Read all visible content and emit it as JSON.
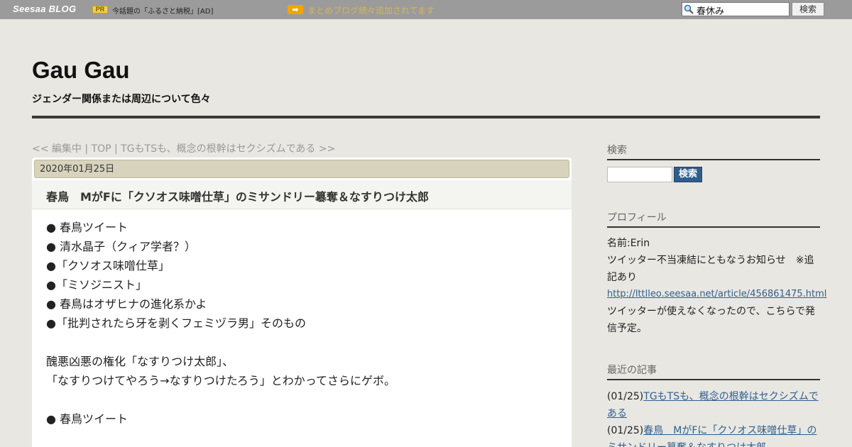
{
  "topbar": {
    "logo_seesaa": "Seesaa",
    "logo_blog": "BLOG",
    "pr_label": "PR",
    "pr_text": "今話題の「ふるさと納税」[AD]",
    "arrow_label": "➡",
    "news_text": "まとめブログ続々追加されてます",
    "search_value": "春休み",
    "search_button": "検索"
  },
  "header": {
    "title": "Gau Gau",
    "description": "ジェンダー関係または周辺について色々"
  },
  "breadcrumb": "<< 編集中 | TOP | TGもTSも、概念の根幹はセクシズムである >>",
  "article": {
    "date": "2020年01月25日",
    "title": "春鳥　MがFに「クソオス味噌仕草」のミサンドリー簒奪＆なすりつけ太郎",
    "lines": [
      "● 春鳥ツイート",
      "● 清水晶子（クィア学者？）",
      "●「クソオス味噌仕草」",
      "●「ミソジニスト」",
      "● 春鳥はオザヒナの進化系かよ",
      "●「批判されたら牙を剥くフェミヅラ男」そのもの",
      "",
      "醜悪凶悪の権化「なすりつけ太郎」、",
      "「なすりつけてやろう→なすりつけたろう」とわかってさらにゲボ。",
      "",
      "● 春鳥ツイート"
    ]
  },
  "sidebar": {
    "search_heading": "検索",
    "search_button": "検索",
    "profile_heading": "プロフィール",
    "profile_name": "名前:Erin",
    "profile_notice": "ツイッター不当凍結にともなうお知らせ　※追記あり",
    "profile_link": "http://lttlleo.seesaa.net/article/456861475.html",
    "profile_after": "ツイッターが使えなくなったので、こちらで発信予定。",
    "recent_heading": "最近の記事",
    "recent": [
      {
        "date": "(01/25)",
        "title": "TGもTSも、概念の根幹はセクシズムである"
      },
      {
        "date": "(01/25)",
        "title": "春鳥　MがFに「クソオス味噌仕草」のミサンドリー簒奪＆なすりつけ太郎"
      }
    ]
  }
}
